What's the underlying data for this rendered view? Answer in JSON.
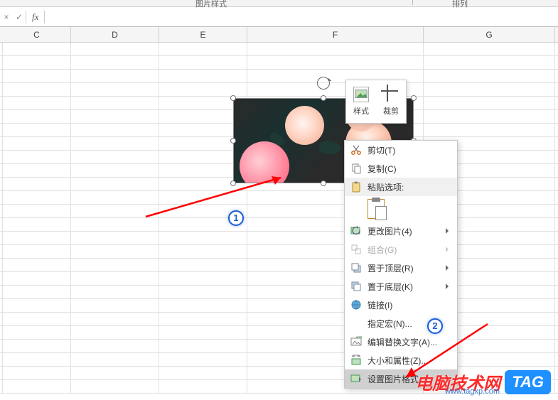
{
  "ribbon": {
    "group1": "图片样式",
    "group2": "排列"
  },
  "formula_bar": {
    "fx": "fx",
    "value": ""
  },
  "columns": [
    "C",
    "D",
    "E",
    "F",
    "G"
  ],
  "mini_toolbar": {
    "style": "样式",
    "crop": "裁剪"
  },
  "context_menu": {
    "cut": "剪切(T)",
    "copy": "复制(C)",
    "paste_header": "粘贴选项:",
    "change_picture": "更改图片(4)",
    "group": "组合(G)",
    "bring_front": "置于顶层(R)",
    "send_back": "置于底层(K)",
    "link": "链接(I)",
    "assign_macro": "指定宏(N)...",
    "edit_alt_text": "编辑替换文字(A)...",
    "size_props": "大小和属性(Z)...",
    "format_picture": "设置图片格式..."
  },
  "annotations": {
    "bubble1": "1",
    "bubble2": "2"
  },
  "watermark": {
    "brand": "电脑技术网",
    "url": "www.tagxp.com",
    "tag": "TAG"
  }
}
